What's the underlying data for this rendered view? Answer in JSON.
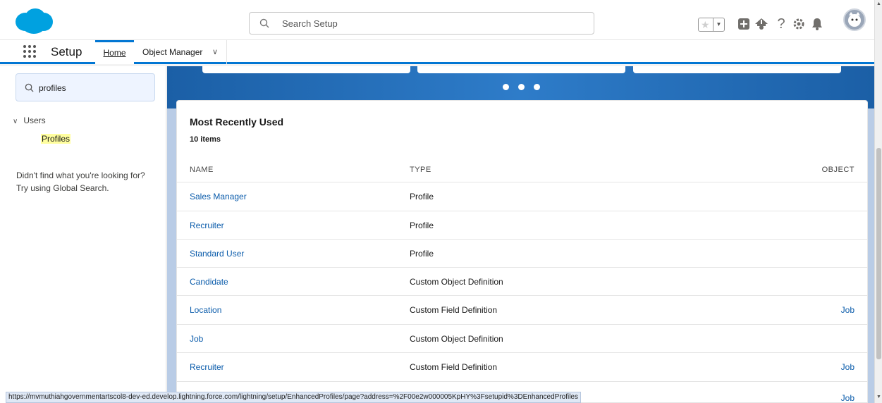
{
  "header": {
    "search_placeholder": "Search Setup",
    "icons": [
      "favorites-star-icon",
      "favorites-dropdown-icon",
      "global-actions-add-icon",
      "trailhead-icon",
      "help-icon",
      "setup-gear-icon",
      "notifications-bell-icon",
      "user-avatar"
    ]
  },
  "nav": {
    "app_name": "Setup",
    "tabs": [
      {
        "label": "Home"
      },
      {
        "label": "Object Manager"
      }
    ]
  },
  "sidebar": {
    "quick_find_value": "profiles",
    "tree": {
      "section": "Users",
      "item": "Profiles"
    },
    "not_found_line1": "Didn't find what you're looking for?",
    "not_found_line2": "Try using Global Search."
  },
  "mru": {
    "title": "Most Recently Used",
    "count": "10 items",
    "columns": [
      "NAME",
      "TYPE",
      "OBJECT"
    ],
    "rows": [
      {
        "name": "Sales Manager",
        "type": "Profile",
        "object": ""
      },
      {
        "name": "Recruiter",
        "type": "Profile",
        "object": ""
      },
      {
        "name": "Standard User",
        "type": "Profile",
        "object": ""
      },
      {
        "name": "Candidate",
        "type": "Custom Object Definition",
        "object": ""
      },
      {
        "name": "Location",
        "type": "Custom Field Definition",
        "object": "Job"
      },
      {
        "name": "Job",
        "type": "Custom Object Definition",
        "object": ""
      },
      {
        "name": "Recruiter",
        "type": "Custom Field Definition",
        "object": "Job"
      },
      {
        "name": "",
        "type": "",
        "object": "Job"
      }
    ]
  },
  "status_url": "https://mvmuthiahgovernmentartscol8-dev-ed.develop.lightning.force.com/lightning/setup/EnhancedProfiles/page?address=%2F00e2w000005KpHY%3Fsetupid%3DEnhancedProfiles",
  "colors": {
    "brand": "#00a1e0",
    "link": "#0b5cab",
    "accent": "#0176d3",
    "highlight": "#fffe9e"
  }
}
